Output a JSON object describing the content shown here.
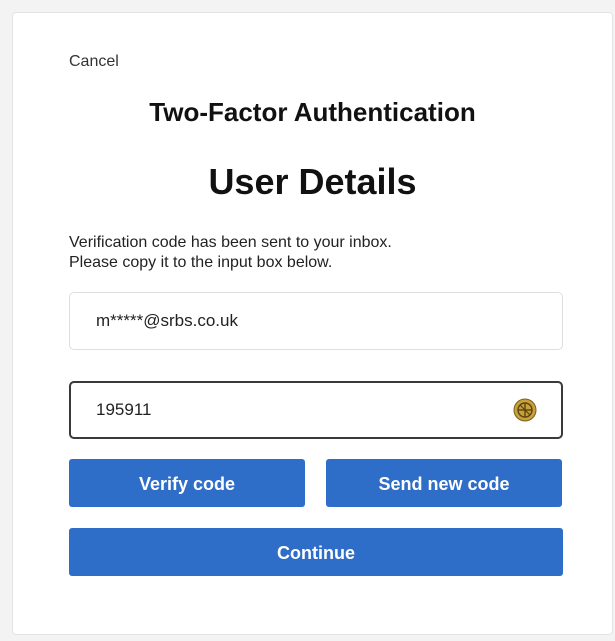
{
  "cancel_label": "Cancel",
  "title": "Two-Factor Authentication",
  "subtitle": "User Details",
  "intro": {
    "line1": "Verification code has been sent to your inbox.",
    "line2": "Please copy it to the input box below."
  },
  "email_value": "m*****@srbs.co.uk",
  "code_value": "195911",
  "buttons": {
    "verify": "Verify code",
    "send_new": "Send new code",
    "continue": "Continue"
  },
  "colors": {
    "primary_button": "#2e6dc8",
    "password_manager_icon": "#c9a13a"
  },
  "icons": {
    "code_field_icon": "password-manager-icon"
  }
}
